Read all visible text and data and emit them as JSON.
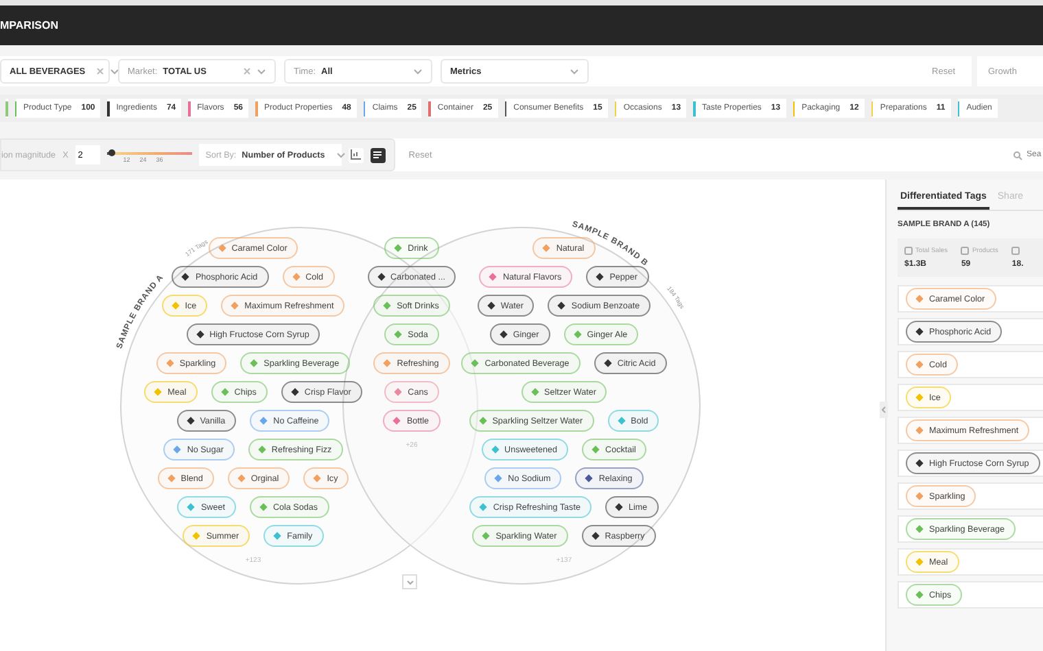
{
  "header": {
    "title": "MPARISON"
  },
  "filters": [
    {
      "value": "ALL BEVERAGES",
      "clearable": true
    },
    {
      "label": "Market:",
      "value": "TOTAL US",
      "clearable": true
    },
    {
      "label": "Time:",
      "value": "All",
      "clearable": false
    },
    {
      "value": "Metrics",
      "clearable": false
    }
  ],
  "filters_reset": "Reset",
  "growth": "Growth",
  "categories": [
    {
      "color": "#8fc97e"
    },
    {
      "name": "Product Type",
      "count": "100",
      "color": "#6bbf59"
    },
    {
      "name": "Ingredients",
      "count": "74",
      "color": "#333333"
    },
    {
      "name": "Flavors",
      "count": "56",
      "color": "#e9709a"
    },
    {
      "name": "Product Properties",
      "count": "48",
      "color": "#f0a060"
    },
    {
      "name": "Claims",
      "count": "25",
      "color": "#6aa7e8"
    },
    {
      "name": "Container",
      "count": "25",
      "color": "#e07070"
    },
    {
      "name": "Consumer Benefits",
      "count": "15",
      "color": "#555555"
    },
    {
      "name": "Occasions",
      "count": "13",
      "color": "#f2d04a"
    },
    {
      "name": "Taste Properties",
      "count": "13",
      "color": "#3cc1d0"
    },
    {
      "name": "Packaging",
      "count": "12",
      "color": "#f2c200"
    },
    {
      "name": "Preparations",
      "count": "11",
      "color": "#f2d04a"
    },
    {
      "name": "Audien",
      "color": "#3cc1d0"
    }
  ],
  "toolbar": {
    "magnitude_label": "ion magnitude",
    "multiplier": "X",
    "magnitude": "2",
    "slider": {
      "level": 0.05,
      "ticks": [
        "12",
        "24",
        "36"
      ]
    },
    "sort_label": "Sort By:",
    "sort_value": "Number of Products",
    "views": [
      {
        "kind": "bars",
        "selected": false
      },
      {
        "kind": "list",
        "selected": true
      }
    ],
    "reset": "Reset",
    "search": {
      "placeholder": "Sea"
    }
  },
  "venn": {
    "left": {
      "name": "SAMPLE BRAND A",
      "tag_count": "171 Tags",
      "more": "+123",
      "rows": [
        [
          {
            "label": "Caramel Color",
            "color": "#f0a060"
          }
        ],
        [
          {
            "label": "Phosphoric Acid",
            "color": "#333333"
          },
          {
            "label": "Cold",
            "color": "#f0a060"
          }
        ],
        [
          {
            "label": "Ice",
            "color": "#f2c200"
          },
          {
            "label": "Maximum Refreshment",
            "color": "#f0a060"
          }
        ],
        [
          {
            "label": "High Fructose Corn Syrup",
            "color": "#333333"
          }
        ],
        [
          {
            "label": "Sparkling",
            "color": "#f0a060"
          },
          {
            "label": "Sparkling Beverage",
            "color": "#6bbf59"
          }
        ],
        [
          {
            "label": "Meal",
            "color": "#f2c200"
          },
          {
            "label": "Chips",
            "color": "#6bbf59"
          },
          {
            "label": "Crisp Flavor",
            "color": "#333333"
          }
        ],
        [
          {
            "label": "Vanilla",
            "color": "#333333"
          },
          {
            "label": "No Caffeine",
            "color": "#6aa7e8"
          }
        ],
        [
          {
            "label": "No Sugar",
            "color": "#6aa7e8"
          },
          {
            "label": "Refreshing Fizz",
            "color": "#6bbf59"
          }
        ],
        [
          {
            "label": "Blend",
            "color": "#f0a060"
          },
          {
            "label": "Orginal",
            "color": "#f0a060"
          },
          {
            "label": "Icy",
            "color": "#f0a060"
          }
        ],
        [
          {
            "label": "Sweet",
            "color": "#3cc1d0"
          },
          {
            "label": "Cola Sodas",
            "color": "#6bbf59"
          }
        ],
        [
          {
            "label": "Summer",
            "color": "#f2c200"
          },
          {
            "label": "Family",
            "color": "#3cc1d0"
          }
        ]
      ]
    },
    "shared": {
      "more": "+26",
      "rows": [
        [
          {
            "label": "Drink",
            "color": "#6bbf59"
          }
        ],
        [
          {
            "label": "Carbonated ...",
            "color": "#333333"
          }
        ],
        [
          {
            "label": "Soft Drinks",
            "color": "#6bbf59"
          }
        ],
        [
          {
            "label": "Soda",
            "color": "#6bbf59"
          }
        ],
        [
          {
            "label": "Refreshing",
            "color": "#f0a060"
          }
        ],
        [
          {
            "label": "Cans",
            "color": "#e88aa0"
          }
        ],
        [
          {
            "label": "Bottle",
            "color": "#e9709a"
          }
        ]
      ]
    },
    "right": {
      "name": "SAMPLE BRAND B",
      "tag_count": "184 Tags",
      "more": "+137",
      "rows": [
        [
          {
            "label": "Natural",
            "color": "#f0a060"
          }
        ],
        [
          {
            "label": "Natural Flavors",
            "color": "#e9709a"
          },
          {
            "label": "Pepper",
            "color": "#333333"
          }
        ],
        [
          {
            "label": "Water",
            "color": "#333333"
          },
          {
            "label": "Sodium Benzoate",
            "color": "#333333"
          }
        ],
        [
          {
            "label": "Ginger",
            "color": "#333333"
          },
          {
            "label": "Ginger Ale",
            "color": "#6bbf59"
          }
        ],
        [
          {
            "label": "Carbonated Beverage",
            "color": "#6bbf59"
          },
          {
            "label": "Citric Acid",
            "color": "#333333"
          }
        ],
        [
          {
            "label": "Seltzer Water",
            "color": "#6bbf59"
          }
        ],
        [
          {
            "label": "Sparkling Seltzer Water",
            "color": "#6bbf59"
          },
          {
            "label": "Bold",
            "color": "#3cc1d0"
          }
        ],
        [
          {
            "label": "Unsweetened",
            "color": "#3cc1d0"
          },
          {
            "label": "Cocktail",
            "color": "#6bbf59"
          }
        ],
        [
          {
            "label": "No Sodium",
            "color": "#6aa7e8"
          },
          {
            "label": "Relaxing",
            "color": "#4a5a9a"
          }
        ],
        [
          {
            "label": "Crisp Refreshing Taste",
            "color": "#3cc1d0"
          },
          {
            "label": "Lime",
            "color": "#333333"
          }
        ],
        [
          {
            "label": "Sparkling Water",
            "color": "#6bbf59"
          },
          {
            "label": "Raspberry",
            "color": "#333333"
          }
        ]
      ]
    }
  },
  "panel": {
    "tabs": [
      {
        "label": "Differentiated Tags",
        "selected": true
      },
      {
        "label": "Share",
        "selected": false
      }
    ],
    "heading": "SAMPLE BRAND A (145)",
    "stats": [
      {
        "label": "Total Sales",
        "value": "$1.3B"
      },
      {
        "label": "Products",
        "value": "59"
      },
      {
        "value": "18."
      }
    ],
    "tags": [
      {
        "label": "Caramel Color",
        "color": "#f0a060"
      },
      {
        "label": "Phosphoric Acid",
        "color": "#333333"
      },
      {
        "label": "Cold",
        "color": "#f0a060"
      },
      {
        "label": "Ice",
        "color": "#f2c200"
      },
      {
        "label": "Maximum Refreshment",
        "color": "#f0a060"
      },
      {
        "label": "High Fructose Corn Syrup",
        "color": "#333333"
      },
      {
        "label": "Sparkling",
        "color": "#f0a060"
      },
      {
        "label": "Sparkling Beverage",
        "color": "#6bbf59"
      },
      {
        "label": "Meal",
        "color": "#f2c200"
      },
      {
        "label": "Chips",
        "color": "#6bbf59"
      }
    ]
  }
}
